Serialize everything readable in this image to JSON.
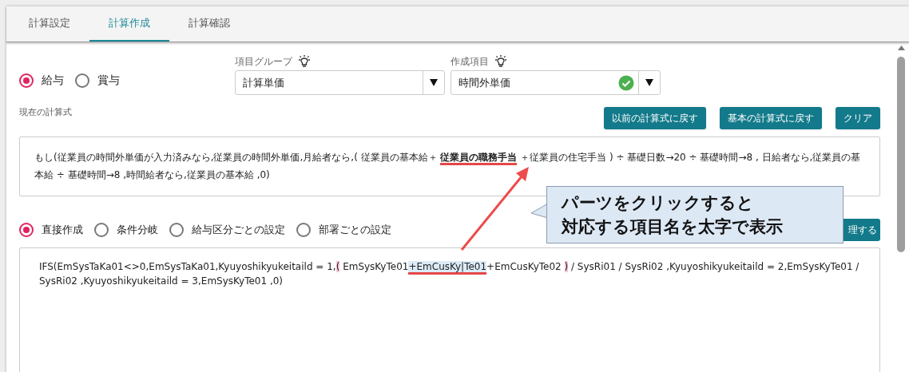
{
  "tabs": [
    {
      "label": "計算設定",
      "selected": false
    },
    {
      "label": "計算作成",
      "selected": true
    },
    {
      "label": "計算確認",
      "selected": false
    }
  ],
  "pay_type": [
    {
      "label": "給与",
      "selected": true
    },
    {
      "label": "賞与",
      "selected": false
    }
  ],
  "selects": [
    {
      "label": "項目グループ",
      "value": "計算単価",
      "valid": false
    },
    {
      "label": "作成項目",
      "value": "時間外単価",
      "valid": true
    }
  ],
  "formula_label": "現在の計算式",
  "buttons": [
    "以前の計算式に戻す",
    "基本の計算式に戻す",
    "クリア"
  ],
  "formula": "もし(従業員の時間外単価が入力済みなら,従業員の時間外単価,月給者なら,( 従業員の基本給＋ **従業員の職務手当** ＋従業員の住宅手当 ) ÷ 基礎日数→20 ÷ 基礎時間→8 , 日給者なら,従業員の基本給 ÷ 基礎時間→8 ,時間給者なら,従業員の基本給 ,0)",
  "modes": [
    {
      "label": "直接作成",
      "selected": true
    },
    {
      "label": "条件分岐",
      "selected": false
    },
    {
      "label": "給与区分ごとの設定",
      "selected": false
    },
    {
      "label": "部署ごとの設定",
      "selected": false
    }
  ],
  "partial_button": "理する",
  "code": [
    {
      "text": "IFS(EmSysTaKa01<>0,EmSysTaKa01,Kyuyoshikyukeitaild = 1,",
      "kind": "plain"
    },
    {
      "text": "(",
      "kind": "bracket"
    },
    {
      "text": " EmSysKyTe01",
      "kind": "plain"
    },
    {
      "text": "+EmCusKy|Te01",
      "kind": "selected"
    },
    {
      "text": "+EmCusKyTe02 ",
      "kind": "plain"
    },
    {
      "text": ")",
      "kind": "bracket"
    },
    {
      "text": " / SysRi01 / SysRi02 ,Kyuyoshikyukeitaild = 2,EmSysKyTe01 / SysRi02 ,Kyuyoshikyukeitaild = 3,EmSysKyTe01 ,0)",
      "kind": "plain"
    }
  ],
  "callout": [
    "パーツをクリックすると",
    "対応する項目名を太字で表示"
  ]
}
